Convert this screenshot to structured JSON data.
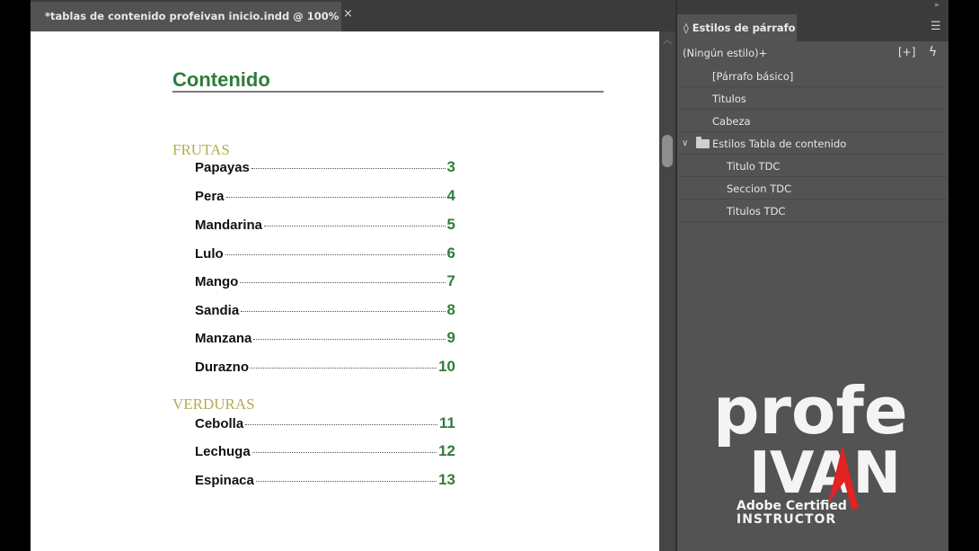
{
  "document_tab": {
    "title": "*tablas de contenido profeivan inicio.indd @ 100%",
    "close_label": "×"
  },
  "toc": {
    "title": "Contenido",
    "sections": [
      {
        "name": "FRUTAS",
        "entries": [
          {
            "name": "Papayas",
            "page": "3"
          },
          {
            "name": "Pera",
            "page": "4"
          },
          {
            "name": "Mandarina",
            "page": "5"
          },
          {
            "name": "Lulo",
            "page": "6"
          },
          {
            "name": "Mango",
            "page": "7"
          },
          {
            "name": "Sandia",
            "page": "8"
          },
          {
            "name": "Manzana",
            "page": "9"
          },
          {
            "name": "Durazno",
            "page": "10"
          }
        ]
      },
      {
        "name": "VERDURAS",
        "entries": [
          {
            "name": "Cebolla",
            "page": "11"
          },
          {
            "name": "Lechuga",
            "page": "12"
          },
          {
            "name": "Espinaca",
            "page": "13"
          }
        ]
      }
    ]
  },
  "panel": {
    "tab_label": "Estilos de párrafo",
    "tab_icon": "◊",
    "menu_icon": "hamburger-icon",
    "collapse_icon": "double-chevron-icon",
    "current_style": "(Ningún estilo)+",
    "new_style_glyph": "[+]",
    "lightning_glyph": "ϟ",
    "styles": [
      {
        "label": "[Párrafo básico]"
      },
      {
        "label": "Titulos"
      },
      {
        "label": "Cabeza"
      }
    ],
    "group": {
      "label": "Estilos Tabla de contenido",
      "children": [
        {
          "label": "Titulo TDC"
        },
        {
          "label": "Seccion TDC"
        },
        {
          "label": "Titulos TDC"
        }
      ]
    }
  },
  "watermark": {
    "line1": "profe",
    "line2": "IVAN",
    "line3": "Adobe Certified",
    "line4": "INSTRUCTOR"
  },
  "colors": {
    "toc_green": "#2e7d3a",
    "section_olive": "#b3ad52",
    "ui_dark": "#535353",
    "logo_red": "#e32222"
  }
}
